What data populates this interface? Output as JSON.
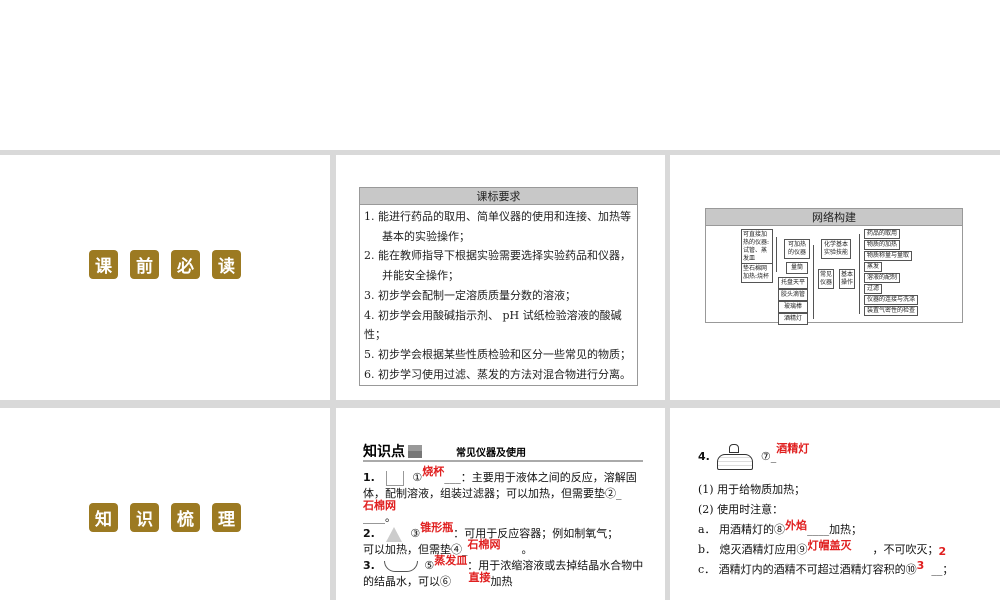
{
  "slide1": {
    "badges": [
      "课",
      "前",
      "必",
      "读"
    ]
  },
  "slide2": {
    "title": "课标要求",
    "items": [
      "1. 能进行药品的取用、简单仪器的使用和连接、加热等",
      "基本的实验操作；",
      "2. 能在教师指导下根据实验需要选择实验药品和仪器，",
      "并能安全操作；",
      "3. 初步学会配制一定溶质质量分数的溶液；",
      "4. 初步学会用酸碱指示剂、 pH 试纸检验溶液的酸碱",
      "性；",
      "5. 初步学会根据某些性质检验和区分一些常见的物质；",
      "6. 初步学习使用过滤、蒸发的方法对混合物进行分离。"
    ]
  },
  "slide3": {
    "title": "网络构建",
    "left_a": "可直接加热的仪器:试管、蒸发皿",
    "left_b": "垫石棉网加热:烧杯",
    "heatable": "可加热的仪器",
    "cylinder": "量筒",
    "balance": "托盘天平",
    "dropper": "胶头滴管",
    "rod": "玻璃棒",
    "lamp": "酒精灯",
    "center": "化学基本实验技能",
    "common": "常见仪器",
    "basic": "基本操作",
    "right": [
      "药品的取用",
      "物质的加热",
      "物质称量与量取",
      "蒸发",
      "溶液的配制",
      "过滤",
      "仪器的连接与洗涤",
      "装置气密性的检查"
    ]
  },
  "slide4": {
    "badges": [
      "知",
      "识",
      "梳",
      "理"
    ]
  },
  "slide5": {
    "heading": "知识点",
    "subtitle": "常见仪器及使用",
    "l1a": "1.",
    "l1b": "①",
    "a1": "烧杯",
    "l1c": "___：主要用于液体之间的反应，溶解固",
    "l1d": "体，配制溶液，组装过滤器；可以加热，但需要垫②_",
    "a2": "石棉网",
    "l1e": "____。",
    "l2a": "2.",
    "l2b": "③",
    "a3": "锥形瓶",
    "l2c": "：可用于反应容器；例如制氧气；",
    "l2d": "可以加热，但需垫④_",
    "a4": "石棉网",
    "l2e": "。",
    "l3a": "3.",
    "l3b": "⑤",
    "a5": "蒸发皿",
    "l3c": "：用于浓缩溶液或去掉结晶水合物中",
    "l3d": "的结晶水，可以⑥",
    "a6": "直接",
    "l3e": "加热"
  },
  "slide6": {
    "num": "4.",
    "c7": "⑦_",
    "a7": "酒精灯",
    "p1": "(1) 用于给物质加热；",
    "p2": "(2) 使用时注意：",
    "pa": "a． 用酒精灯的⑧",
    "a8": "外焰",
    "pa2": "____加热；",
    "pb": "b． 熄灭酒精灯应用⑨",
    "a9": "灯帽盖灭",
    "pb2": "，不可吹灭；",
    "pc": "c． 酒精灯内的酒精不可超过酒精灯容积的⑩",
    "a10n": "2",
    "a10d": "3",
    "pc2": "__；"
  }
}
